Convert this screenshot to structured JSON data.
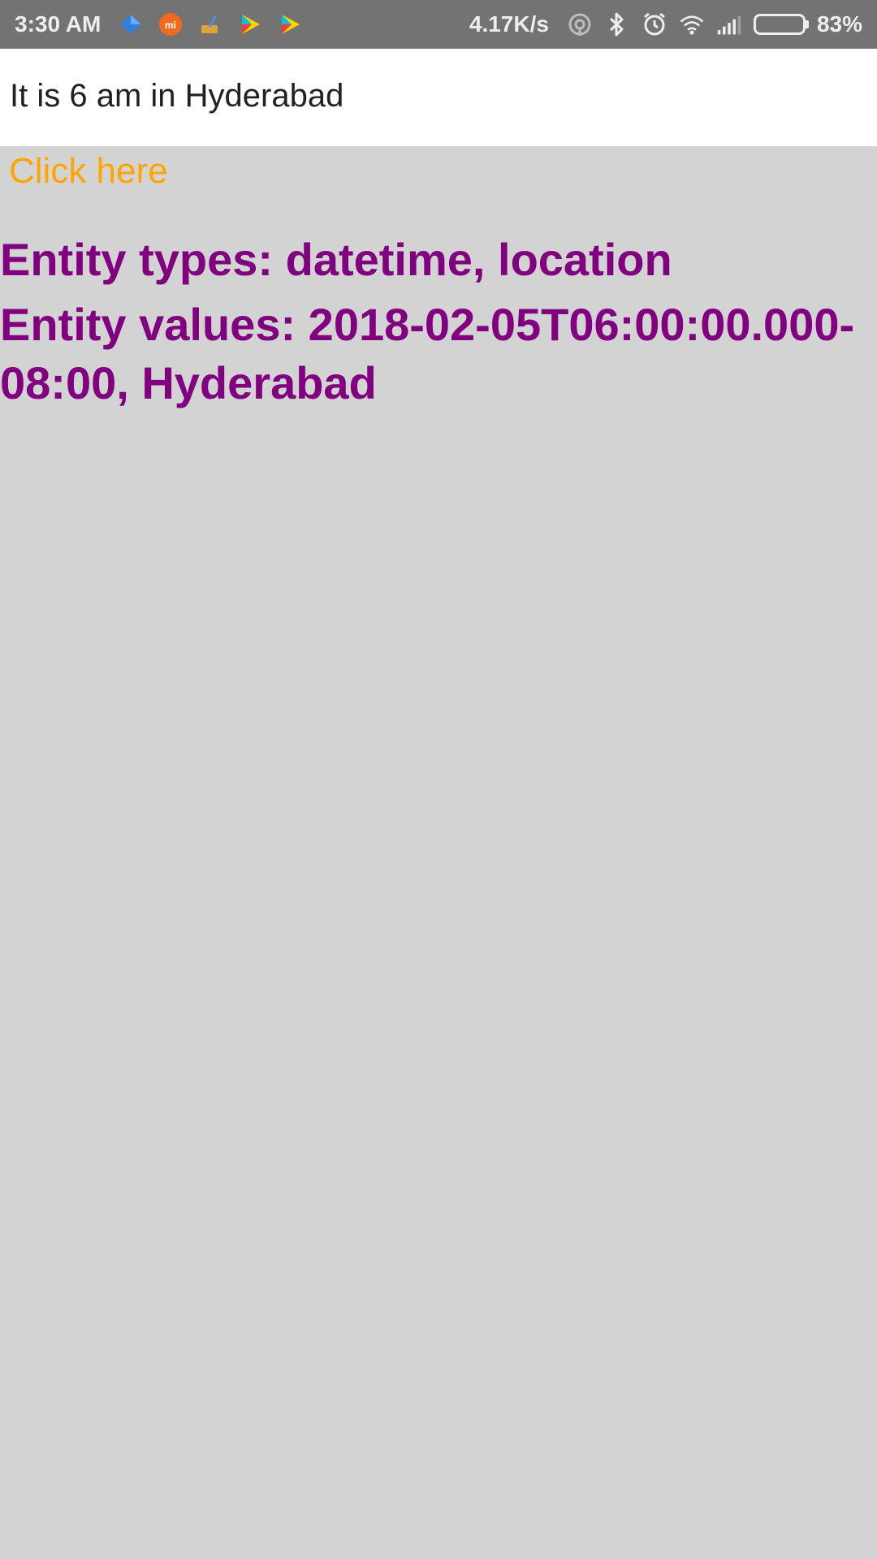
{
  "status_bar": {
    "time": "3:30 AM",
    "network_speed": "4.17K/s",
    "battery_percent": "83%",
    "battery_level": 0.83,
    "app_icons": [
      "blue-diamond-icon",
      "mi-icon",
      "cleaner-icon",
      "play-store-icon",
      "play-store-icon"
    ],
    "system_icons": [
      "hotspot-icon",
      "bluetooth-icon",
      "alarm-icon",
      "wifi-icon",
      "signal-icon",
      "battery-icon"
    ]
  },
  "query": {
    "text": "It is 6 am in Hyderabad"
  },
  "action": {
    "label": "Click here",
    "color": "#ffa500"
  },
  "entities": {
    "types_text": "Entity types: datetime, location",
    "values_text": "Entity values: 2018-02-05T06:00:00.000-08:00, Hyderabad",
    "color": "#800080"
  },
  "colors": {
    "status_bar_bg": "#737373",
    "content_bg": "#d3d3d3",
    "input_bg": "#ffffff"
  }
}
